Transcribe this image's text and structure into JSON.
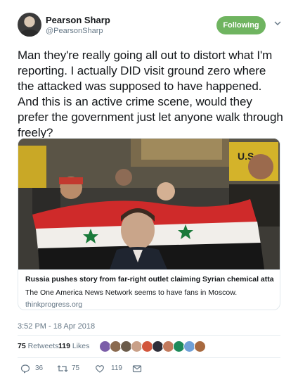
{
  "author": {
    "name": "Pearson Sharp",
    "handle": "@PearsonSharp",
    "follow_label": "Following"
  },
  "tweet": {
    "text": "Man they're really going all out to distort what I'm reporting. I actually DID visit ground zero where the attacked was supposed to have happened. And this is an active crime scene, would they prefer the government just let anyone walk through freely?",
    "timestamp": "3:52 PM - 18 Apr 2018"
  },
  "card": {
    "title": "Russia pushes story from far-right outlet claiming Syrian chemical attack wa...",
    "description": "The One America News Network seems to have fans in Moscow.",
    "domain": "thinkprogress.org",
    "image_sign_text": "U.S."
  },
  "stats": {
    "retweets_count": "75",
    "retweets_label": "Retweets",
    "likes_count": "119",
    "likes_label": "Likes"
  },
  "likers": [
    "#7b5da8",
    "#8a6a4f",
    "#6b5b4a",
    "#c9a088",
    "#d2563c",
    "#2f2f3a",
    "#c27a5d",
    "#1d8a5a",
    "#6fa0d8",
    "#a8693f"
  ],
  "actions": {
    "reply_count": "36",
    "retweet_count": "75",
    "like_count": "119"
  },
  "colors": {
    "follow_button": "#6fb460",
    "secondary_text": "#657786",
    "primary_text": "#14171a"
  }
}
